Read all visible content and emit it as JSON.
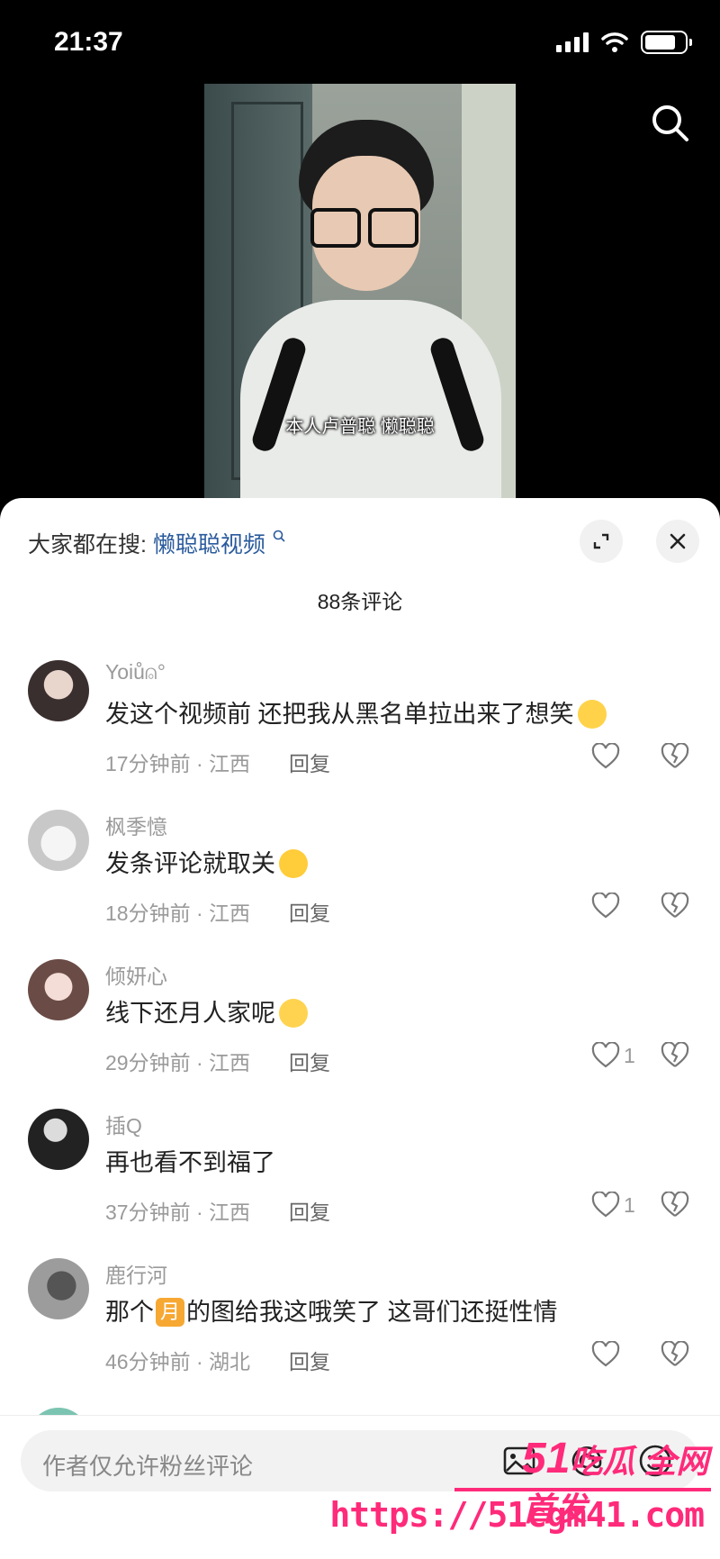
{
  "status_bar": {
    "time": "21:37"
  },
  "video": {
    "subtitle": "本人卢普聪 懒聪聪"
  },
  "panel": {
    "trending_prefix": "大家都在搜:",
    "trending_keyword": "懒聪聪视频",
    "comment_count": "88条评论"
  },
  "comments": [
    {
      "username": "Yoiů⍝°",
      "text": "发这个视频前 还把我从黑名单拉出来了想笑",
      "emoji": "crying-rainbow",
      "time": "17分钟前 · 江西",
      "reply": "回复",
      "likes": ""
    },
    {
      "username": "枫季憶",
      "text": "发条评论就取关",
      "emoji": "drooling",
      "time": "18分钟前 · 江西",
      "reply": "回复",
      "likes": ""
    },
    {
      "username": "倾妍心",
      "text": "线下还月人家呢",
      "emoji": "laughing-tears",
      "time": "29分钟前 · 江西",
      "reply": "回复",
      "likes": "1"
    },
    {
      "username": "插Q",
      "text": "再也看不到福了",
      "emoji": "",
      "time": "37分钟前 · 江西",
      "reply": "回复",
      "likes": "1"
    },
    {
      "username": "鹿行河",
      "text_before": "那个",
      "tag": "月",
      "text_after": "的图给我这哦笑了 这哥们还挺性情",
      "time": "46分钟前 · 湖北",
      "reply": "回复",
      "likes": ""
    }
  ],
  "input": {
    "placeholder": "作者仅允许粉丝评论"
  },
  "watermark": {
    "line1_num": "51",
    "line1_text": "吃瓜 全网首发",
    "line2": "https://51cgm41.com"
  },
  "colors": {
    "accent_link": "#2a5a9c",
    "watermark": "#ff2a7a",
    "panel_bg": "#ffffff"
  },
  "icons": [
    "search-icon",
    "expand-icon",
    "close-icon",
    "heart-icon",
    "broken-heart-icon",
    "image-icon",
    "at-icon",
    "emoji-icon"
  ]
}
